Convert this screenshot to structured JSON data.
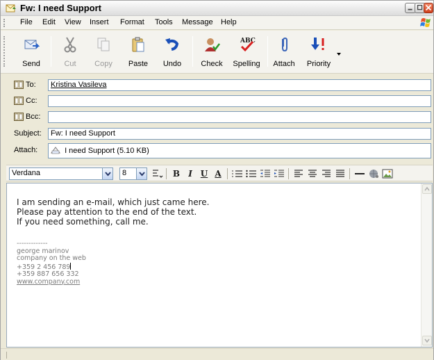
{
  "window": {
    "title": "Fw: I need Support"
  },
  "menu": {
    "items": [
      "File",
      "Edit",
      "View",
      "Insert",
      "Format",
      "Tools",
      "Message",
      "Help"
    ]
  },
  "toolbar": {
    "send": "Send",
    "cut": "Cut",
    "copy": "Copy",
    "paste": "Paste",
    "undo": "Undo",
    "check": "Check",
    "spelling": "Spelling",
    "spelling_badge": "ABC",
    "attach": "Attach",
    "priority": "Priority"
  },
  "headers": {
    "to_label": "To:",
    "to_value": "Kristina Vasileva",
    "cc_label": "Cc:",
    "cc_value": "",
    "bcc_label": "Bcc:",
    "bcc_value": "",
    "subject_label": "Subject:",
    "subject_value": "Fw: I need Support",
    "attach_label": "Attach:",
    "attach_value": "I need Support (5.10 KB)"
  },
  "format": {
    "font": "Verdana",
    "size": "8",
    "bold": "B",
    "italic": "I",
    "underline": "U",
    "color": "A"
  },
  "body": {
    "lines": [
      "I am sending an e-mail, which just came here.",
      "Please pay attention to the end of the text.",
      "If you need something, call me."
    ],
    "signature": {
      "separator": "-------------",
      "name": "george marinov",
      "company": "company on the web",
      "phone1": "+359 2 456 789",
      "phone2": "+359 887 656 332",
      "website": "www.company.com"
    }
  },
  "colors": {
    "accent": "#316ac5",
    "close_button": "#d0401c",
    "field_border": "#7f9db9"
  }
}
